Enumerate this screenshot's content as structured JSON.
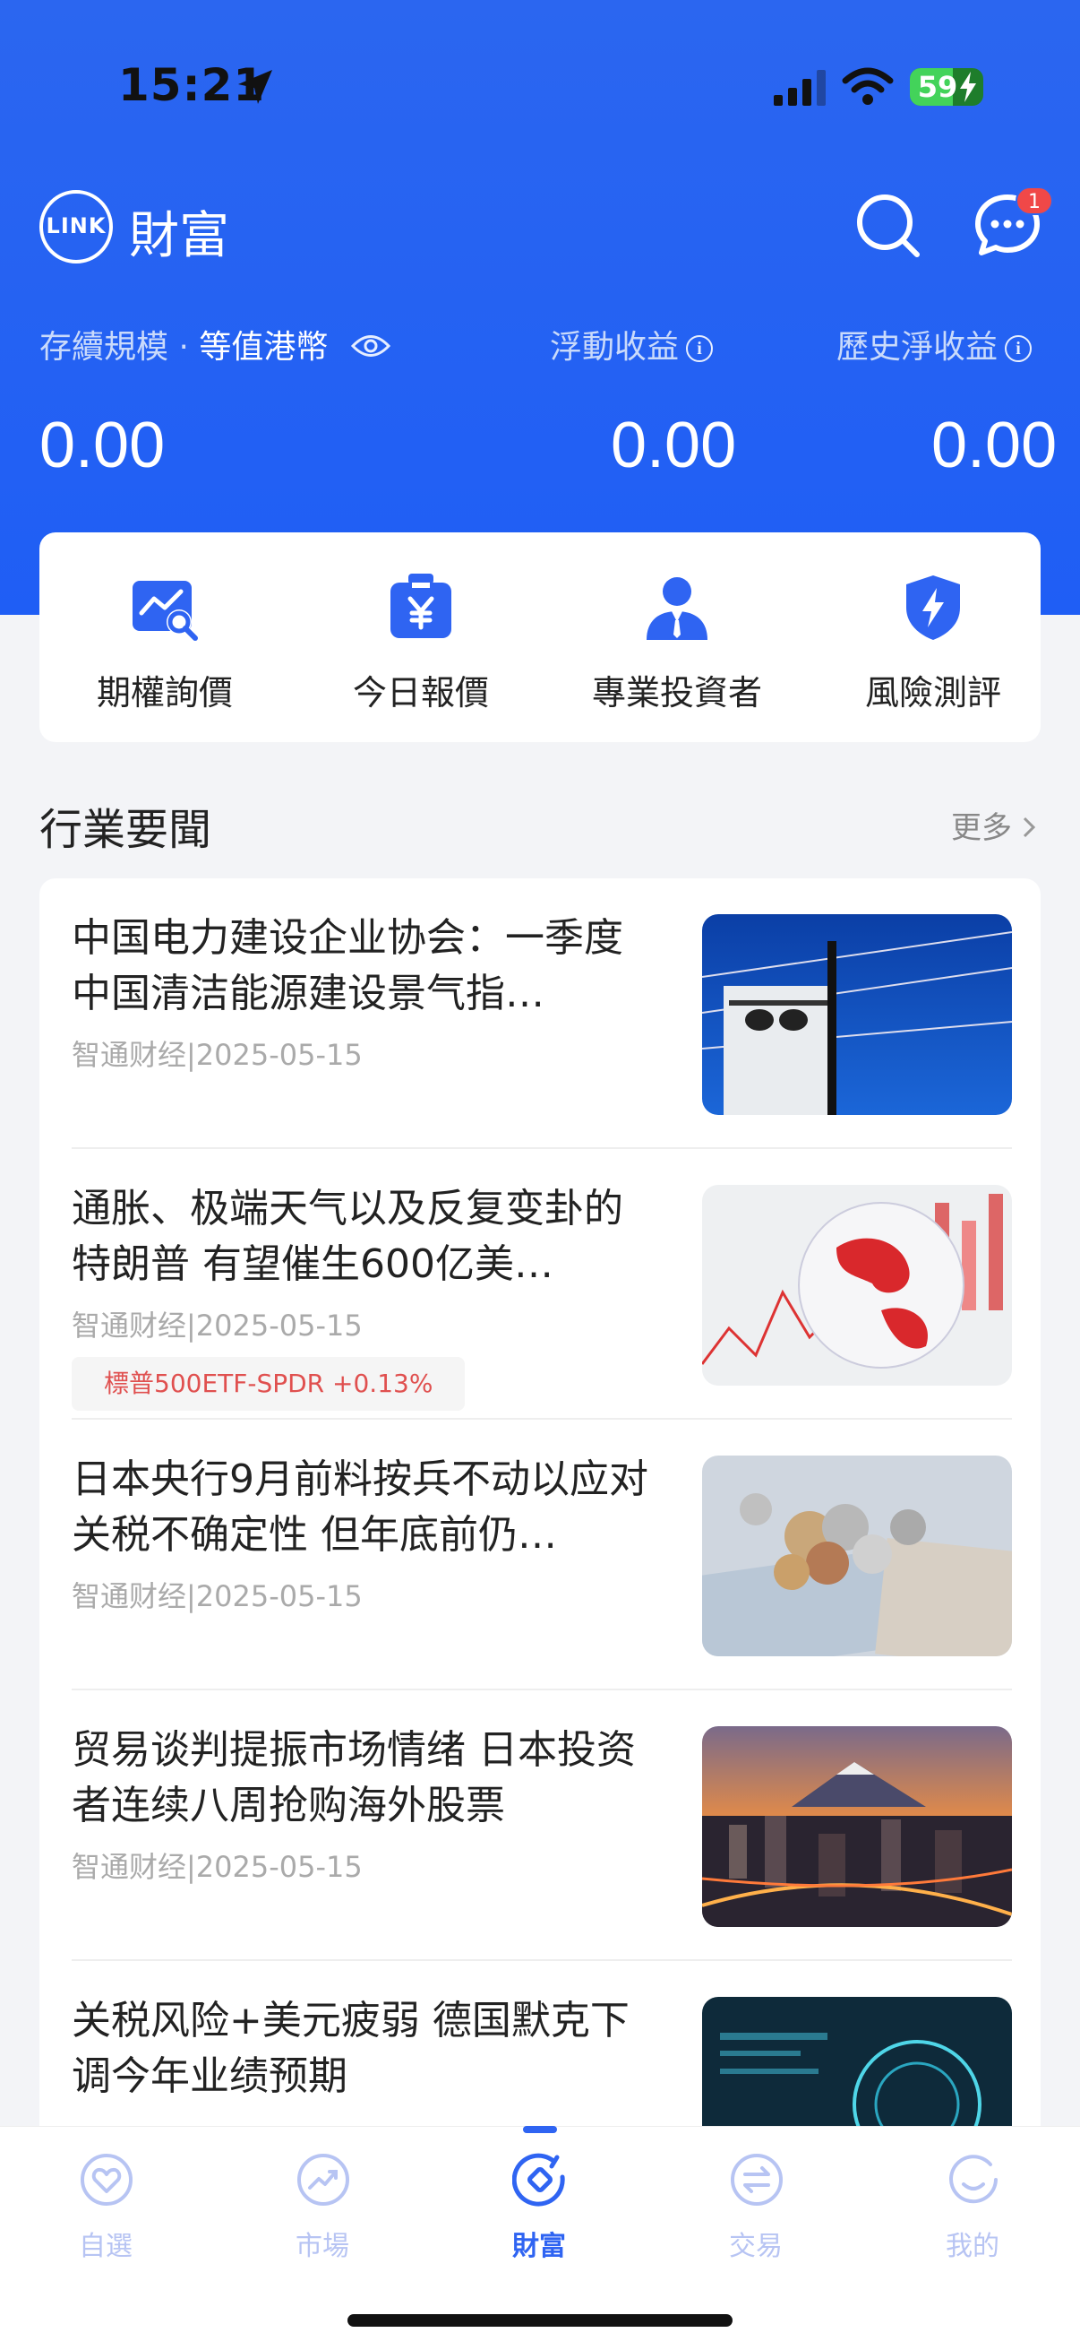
{
  "status_bar": {
    "time": "15:21",
    "battery": "59",
    "battery_level": 0.59
  },
  "header": {
    "logo_text": "LINK",
    "title": "財富",
    "message_badge": "1"
  },
  "stats": {
    "label_scale": "存續規模 · ",
    "label_currency": "等值港幣",
    "label_floating": "浮動收益",
    "label_history": "歷史淨收益",
    "value_scale": "0.00",
    "value_floating": "0.00",
    "value_history": "0.00"
  },
  "quick_actions": [
    {
      "label": "期權詢價",
      "icon": "chart-search-icon"
    },
    {
      "label": "今日報價",
      "icon": "yen-badge-icon"
    },
    {
      "label": "專業投資者",
      "icon": "person-icon"
    },
    {
      "label": "風險測評",
      "icon": "shield-bolt-icon"
    }
  ],
  "news_section": {
    "title": "行業要聞",
    "more": "更多",
    "items": [
      {
        "title": "中国电力建设企业协会：一季度中国清洁能源建设景气指…",
        "meta": "智通财经|2025-05-15",
        "tag": ""
      },
      {
        "title": "通胀、极端天气以及反复变卦的特朗普 有望催生600亿美…",
        "meta": "智通财经|2025-05-15",
        "tag": "標普500ETF-SPDR +0.13%"
      },
      {
        "title": "日本央行9月前料按兵不动以应对关税不确定性 但年底前仍…",
        "meta": "智通财经|2025-05-15",
        "tag": ""
      },
      {
        "title": "贸易谈判提振市场情绪 日本投资者连续八周抢购海外股票",
        "meta": "智通财经|2025-05-15",
        "tag": ""
      },
      {
        "title": "关税风险+美元疲弱 德国默克下调今年业绩预期",
        "meta": "",
        "tag": ""
      }
    ]
  },
  "tabbar": {
    "tabs": [
      {
        "label": "自選",
        "icon": "heart-icon"
      },
      {
        "label": "市場",
        "icon": "trend-icon"
      },
      {
        "label": "財富",
        "icon": "wealth-icon"
      },
      {
        "label": "交易",
        "icon": "exchange-icon"
      },
      {
        "label": "我的",
        "icon": "smile-icon"
      }
    ],
    "active_index": 2
  },
  "colors": {
    "primary": "#2B66F0",
    "accent_red": "#E0504F",
    "badge": "#F04848"
  }
}
